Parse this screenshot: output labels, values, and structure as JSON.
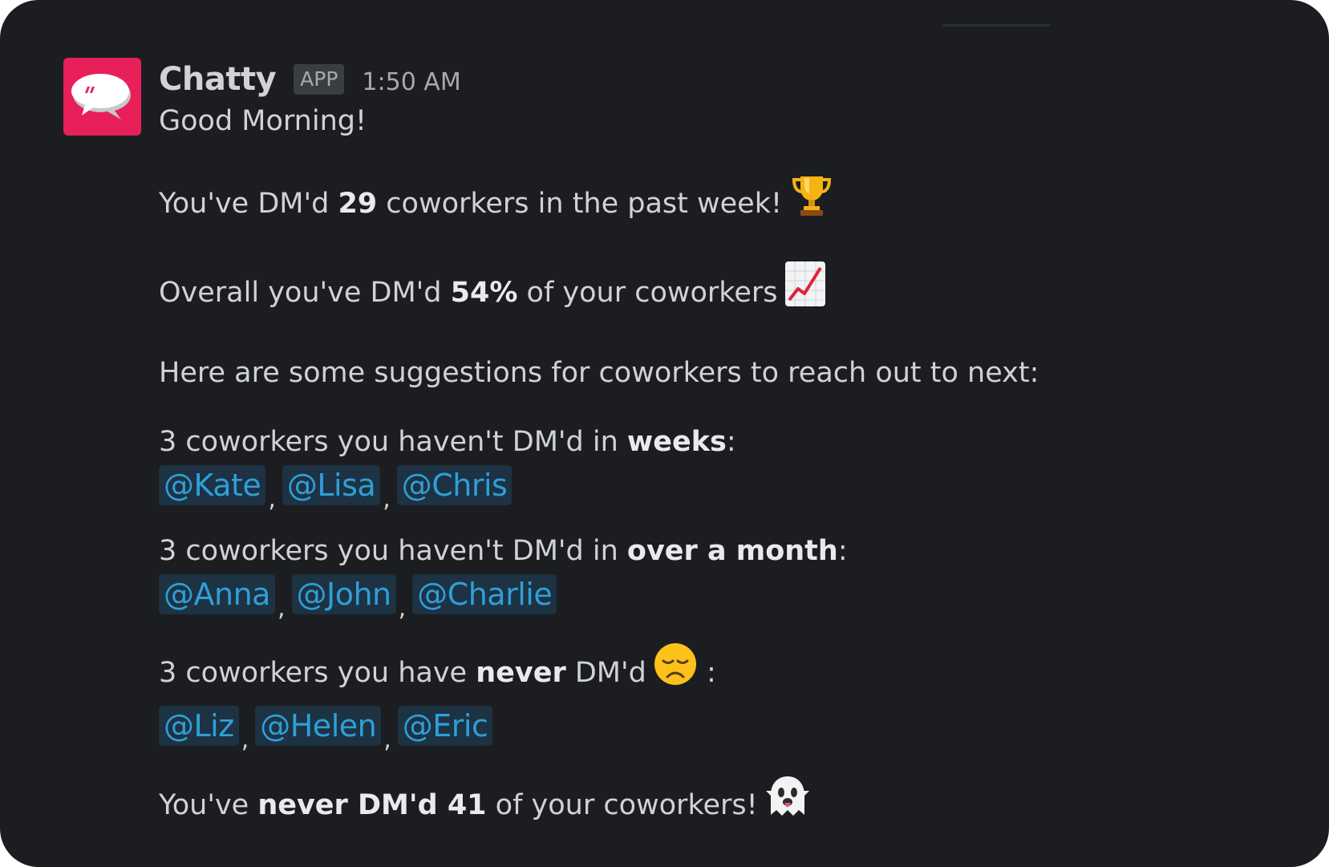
{
  "message": {
    "sender": "Chatty",
    "badge": "APP",
    "timestamp": "1:50 AM",
    "greeting": "Good Morning!",
    "week_line": {
      "pre": "You've DM'd ",
      "count": "29",
      "post": " coworkers in the past week!",
      "emoji": "trophy-emoji"
    },
    "overall_line": {
      "pre": "Overall you've DM'd ",
      "percent": "54%",
      "post": " of your coworkers",
      "emoji": "chart-increasing-emoji"
    },
    "suggestions_intro": "Here are some suggestions for coworkers to reach out to next:",
    "weeks_group": {
      "pre": "3 coworkers you haven't DM'd in ",
      "bold": "weeks",
      "post": ":",
      "mentions": [
        "@Kate",
        "@Lisa",
        "@Chris"
      ]
    },
    "month_group": {
      "pre": "3 coworkers you haven't DM'd in ",
      "bold": "over a month",
      "post": ":",
      "mentions": [
        "@Anna",
        "@John",
        "@Charlie"
      ]
    },
    "never_group": {
      "pre": "3 coworkers you have ",
      "bold": "never",
      "post": " DM'd",
      "after_emoji": " :",
      "emoji": "disappointed-face-emoji",
      "mentions": [
        "@Liz",
        "@Helen",
        "@Eric"
      ]
    },
    "final_line": {
      "pre": "You've ",
      "bold1": "never DM'd",
      "space": " ",
      "bold2": "41",
      "post": " of your coworkers!",
      "emoji": "ghost-emoji"
    },
    "separator": ","
  },
  "colors": {
    "background": "#1b1d21",
    "text": "#d1d2d3",
    "avatar": "#e8205a",
    "mention_text": "#2e9fd8",
    "mention_bg": "#1d3243"
  }
}
